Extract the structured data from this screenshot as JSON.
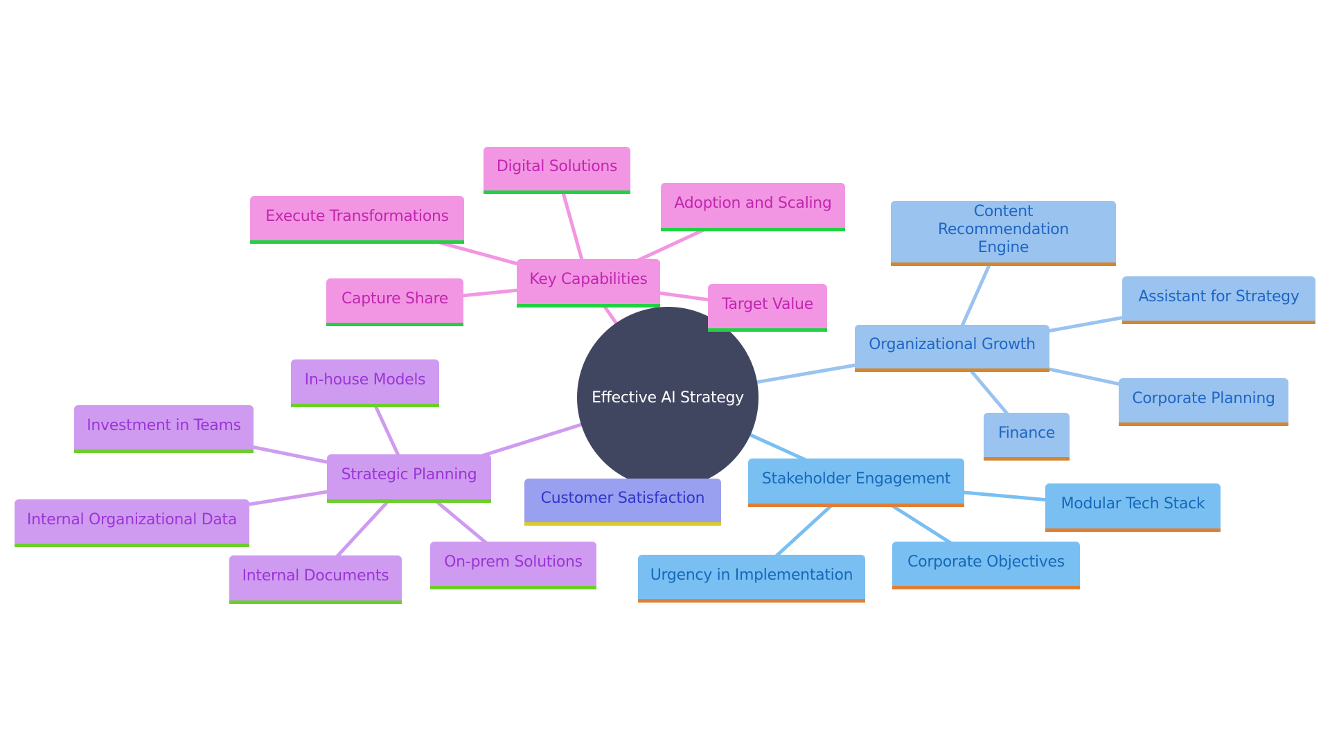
{
  "diagram": {
    "type": "mindmap",
    "root": {
      "id": "root",
      "label": "Effective AI Strategy",
      "color": "#414660",
      "text_color": "#ffffff"
    },
    "groups": {
      "pink": {
        "fill": "#f296e3",
        "text": "#c126ae",
        "accent": "#22d043",
        "edge": "#f296e3"
      },
      "purple": {
        "fill": "#cf9bf0",
        "text": "#9b35d6",
        "accent": "#6bcf2b",
        "edge": "#cf9bf0"
      },
      "blue1": {
        "fill": "#9ac3ef",
        "text": "#1f66c4",
        "accent": "#d4862c",
        "edge": "#9ac3ef"
      },
      "blue2": {
        "fill": "#7abff2",
        "text": "#1569b8",
        "accent": "#e07f33",
        "edge": "#7abff2"
      },
      "indigo": {
        "fill": "#9aa0f0",
        "text": "#2f37c9",
        "accent": "#d9cb2c",
        "edge": "#9aa0f0"
      }
    },
    "nodes": [
      {
        "id": "key-capabilities",
        "label": "Key Capabilities",
        "group": "pink",
        "parent": "root"
      },
      {
        "id": "digital-solutions",
        "label": "Digital Solutions",
        "group": "pink",
        "parent": "key-capabilities"
      },
      {
        "id": "adoption-and-scaling",
        "label": "Adoption and Scaling",
        "group": "pink",
        "parent": "key-capabilities"
      },
      {
        "id": "execute-transformations",
        "label": "Execute Transformations",
        "group": "pink",
        "parent": "key-capabilities"
      },
      {
        "id": "capture-share",
        "label": "Capture Share",
        "group": "pink",
        "parent": "key-capabilities"
      },
      {
        "id": "target-value",
        "label": "Target Value",
        "group": "pink",
        "parent": "key-capabilities"
      },
      {
        "id": "organizational-growth",
        "label": "Organizational Growth",
        "group": "blue1",
        "parent": "root"
      },
      {
        "id": "content-recommendation-engine",
        "label": "Content Recommendation Engine",
        "group": "blue1",
        "parent": "organizational-growth"
      },
      {
        "id": "assistant-for-strategy",
        "label": "Assistant for Strategy",
        "group": "blue1",
        "parent": "organizational-growth"
      },
      {
        "id": "corporate-planning",
        "label": "Corporate Planning",
        "group": "blue1",
        "parent": "organizational-growth"
      },
      {
        "id": "finance",
        "label": "Finance",
        "group": "blue1",
        "parent": "organizational-growth"
      },
      {
        "id": "stakeholder-engagement",
        "label": "Stakeholder Engagement",
        "group": "blue2",
        "parent": "root"
      },
      {
        "id": "modular-tech-stack",
        "label": "Modular Tech Stack",
        "group": "blue2",
        "parent": "stakeholder-engagement"
      },
      {
        "id": "corporate-objectives",
        "label": "Corporate Objectives",
        "group": "blue2",
        "parent": "stakeholder-engagement"
      },
      {
        "id": "urgency-in-implementation",
        "label": "Urgency in Implementation",
        "group": "blue2",
        "parent": "stakeholder-engagement"
      },
      {
        "id": "customer-satisfaction",
        "label": "Customer Satisfaction",
        "group": "indigo",
        "parent": "root"
      },
      {
        "id": "strategic-planning",
        "label": "Strategic Planning",
        "group": "purple",
        "parent": "root"
      },
      {
        "id": "in-house-models",
        "label": "In-house Models",
        "group": "purple",
        "parent": "strategic-planning"
      },
      {
        "id": "investment-in-teams",
        "label": "Investment in Teams",
        "group": "purple",
        "parent": "strategic-planning"
      },
      {
        "id": "internal-organizational-data",
        "label": "Internal Organizational Data",
        "group": "purple",
        "parent": "strategic-planning"
      },
      {
        "id": "internal-documents",
        "label": "Internal Documents",
        "group": "purple",
        "parent": "strategic-planning"
      },
      {
        "id": "on-prem-solutions",
        "label": "On-prem Solutions",
        "group": "purple",
        "parent": "strategic-planning"
      }
    ]
  }
}
